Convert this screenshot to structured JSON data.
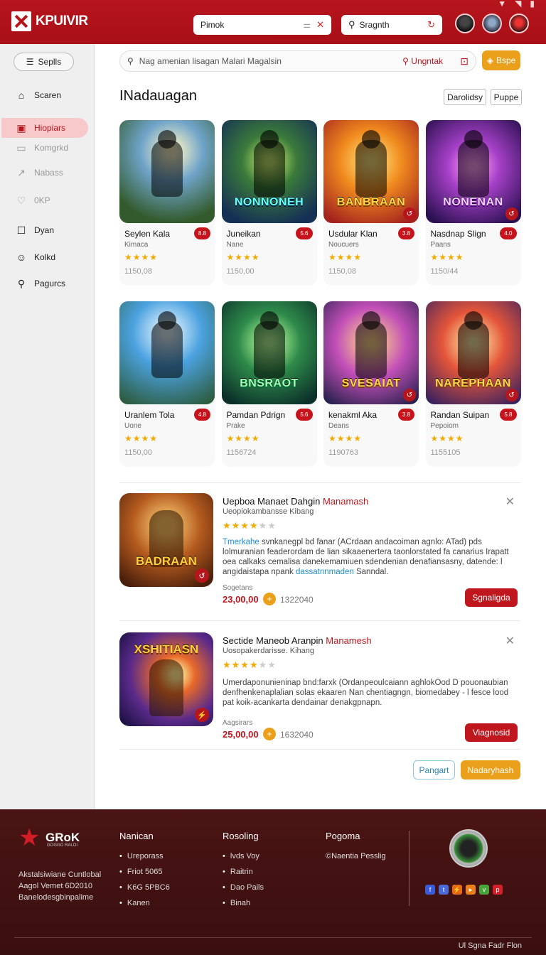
{
  "app": {
    "brand": "KPUIVIR"
  },
  "topbar": {
    "search1_value": "Pimok",
    "search2_value": "Sragnth",
    "status_icons": [
      "signal-icon",
      "wifi-icon",
      "battery-icon"
    ]
  },
  "sidebar": {
    "button_label": "Seplls",
    "items": [
      {
        "label": "Scaren",
        "icon": "home-icon"
      },
      {
        "label": "Hiopiars",
        "icon": "briefcase-icon"
      },
      {
        "label": "Komgrkd",
        "icon": "grid-icon"
      },
      {
        "label": "Nabass",
        "icon": "chart-icon"
      },
      {
        "label": "0KP",
        "icon": "heart-icon"
      },
      {
        "label": "Dyan",
        "icon": "calendar-icon"
      },
      {
        "label": "Kolkd",
        "icon": "smile-icon"
      },
      {
        "label": "Pagurcs",
        "icon": "pin-icon"
      }
    ]
  },
  "main": {
    "search_placeholder": "Nag amenian lisagan Malari Magalsin",
    "search_action": "Ungntak",
    "tag_button": "Bspe",
    "section_title": "INadauagan",
    "filters": [
      "Darolidsy",
      "Puppe"
    ],
    "cards": [
      {
        "name": "Seylen Kala",
        "badge": "8.8",
        "sub": "Kimaca",
        "stars": "★★★★",
        "num": "1150,08",
        "banner": "",
        "palette": "g1"
      },
      {
        "name": "Juneikan",
        "badge": "5.6",
        "sub": "Nane",
        "stars": "★★★★",
        "num": "1150,00",
        "banner": "NONNONEH",
        "palette": "g2"
      },
      {
        "name": "Usdular Klan",
        "badge": "3.8",
        "sub": "Noucuers",
        "stars": "★★★★",
        "num": "1150,08",
        "banner": "BANBRAAN",
        "palette": "g3"
      },
      {
        "name": "Nasdnap Slign",
        "badge": "4.0",
        "sub": "Paans",
        "stars": "★★★★",
        "num": "1150/44",
        "banner": "NONENAN",
        "palette": "g4"
      },
      {
        "name": "Uranlem Tola",
        "badge": "4.8",
        "sub": "Uone",
        "stars": "★★★★",
        "num": "1150,00",
        "banner": "",
        "palette": "g5"
      },
      {
        "name": "Pamdan Pdrign",
        "badge": "5.6",
        "sub": "Prake",
        "stars": "★★★★",
        "num": "1156724",
        "banner": "BNSRAOT",
        "palette": "g6"
      },
      {
        "name": "kenakml Aka",
        "badge": "3.8",
        "sub": "Deans",
        "stars": "★★★★",
        "num": "1190763",
        "banner": "SVESAIAT",
        "palette": "g7"
      },
      {
        "name": "Randan Suipan",
        "badge": "5.8",
        "sub": "Pepoiom",
        "stars": "★★★★",
        "num": "1155105",
        "banner": "NAREPHAAN",
        "palette": "g8"
      }
    ],
    "featured": [
      {
        "title": "Uepboa Manaet Dahgin ",
        "title_red": "Manamash",
        "sub": "Ueopiokambansse Kibang",
        "stars": "★★★★",
        "stars_dim": "★★",
        "desc_blue": "Tmerkahe",
        "desc": " svnkanegpl bd fanar (ACrdaan andacoiman agnlo: ATad) pds lolmuranian feaderordam de lian sikaaenertera taonlorstated fa canarius Irapatt oea calkaks cemalisa danekemamiuen sdendenian denafiansasny, datende: l angidaistapa npank ",
        "desc_blue2": "dassatnnmaden",
        "desc_end": " Sanndal.",
        "price_label": "Sogetans",
        "price": "23,00,00",
        "count": "1322040",
        "button": "Sgnaligda",
        "banner": "BADRAAN"
      },
      {
        "title": "Sectide Maneob Aranpin ",
        "title_red": "Manamesh",
        "sub": "Uosopakerdarisse. Kihang",
        "stars": "★★★★",
        "stars_dim": "★★",
        "desc_blue": "",
        "desc": "Umerdaponunieninap bnd:farxk (Ordanpeoulcaiann aghlokOod D pouonaubian denfhenkenaplalian solas ekaaren Nan chentiagngn, biomedabey - l fesce lood pat koik-acankarta dendainar denakgpnapn.",
        "desc_blue2": "",
        "desc_end": "",
        "price_label": "Aagsirars",
        "price": "25,00,00",
        "count": "1632040",
        "button": "Viagnosid",
        "banner": "XSHITIASN"
      }
    ],
    "pager": {
      "prev": "Pangart",
      "next": "Nadaryhash"
    }
  },
  "footer": {
    "brand": "GRoK",
    "brand_tag": "GOGGO RALOI",
    "address": [
      "Akstalsiwiane Cuntlobal",
      "Aagol Vemet 6D2010",
      "Banelodesgbinpalime"
    ],
    "col1": {
      "title": "Nanican",
      "items": [
        "Ureporass",
        "Friot 5065",
        "K6G 5PBC6",
        "Kanen"
      ]
    },
    "col2": {
      "title": "Rosoling",
      "items": [
        "lvds Voy",
        "Raitrin",
        "Dao Pails",
        "Binah"
      ]
    },
    "col3": {
      "title": "Pogoma",
      "items": [
        "©Naentia Pesslig"
      ]
    },
    "social": [
      {
        "icon": "facebook-icon",
        "color": "#3b5bd6",
        "glyph": "f"
      },
      {
        "icon": "twitter-icon",
        "color": "#4a6ad8",
        "glyph": "t"
      },
      {
        "icon": "rss-icon",
        "color": "#e56a16",
        "glyph": "⚡"
      },
      {
        "icon": "youtube-icon",
        "color": "#e8811a",
        "glyph": "▸"
      },
      {
        "icon": "vine-icon",
        "color": "#47a33a",
        "glyph": "v"
      },
      {
        "icon": "pinterest-icon",
        "color": "#d2212a",
        "glyph": "p"
      }
    ],
    "bottom": "Ul Sgna  Fadr Flon"
  }
}
